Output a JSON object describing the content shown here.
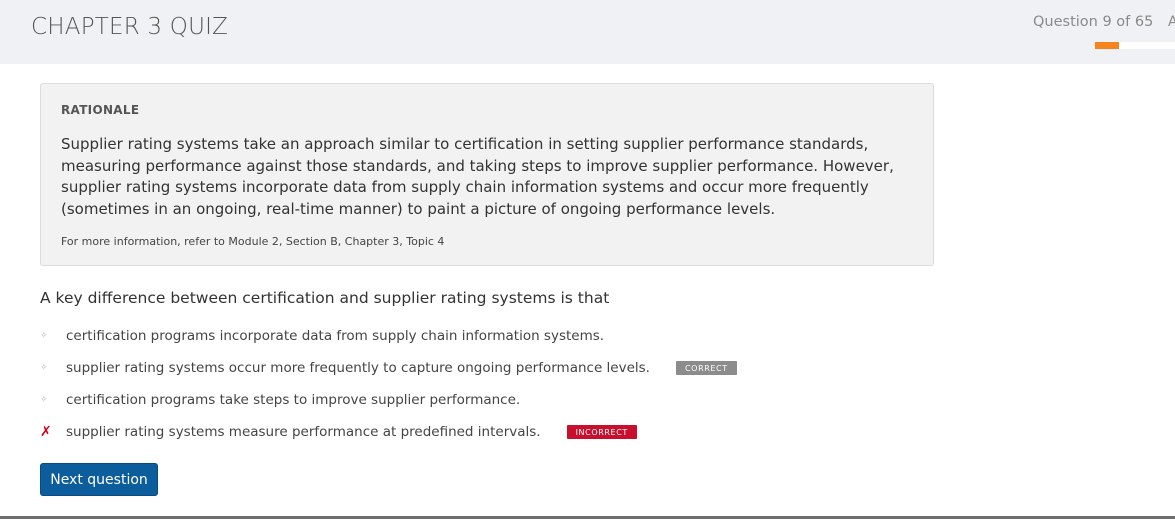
{
  "header": {
    "title": "CHAPTER 3 QUIZ",
    "progress_label": "Question 9 of 65",
    "progress_fraction": 0.3,
    "accent_color": "#f5841f",
    "edge_glyph": "A"
  },
  "rationale": {
    "heading": "RATIONALE",
    "body": "Supplier rating systems take an approach similar to certification in setting supplier performance standards, measuring performance against those standards, and taking steps to improve supplier performance. However, supplier rating systems incorporate data from supply chain information systems and occur more frequently (sometimes in an ongoing, real-time manner) to paint a picture of ongoing performance levels.",
    "reference": "For more information, refer to Module 2, Section B, Chapter 3, Topic 4"
  },
  "question": {
    "text": "A key difference between certification and supplier rating systems is that",
    "answers": [
      {
        "mark": "✧",
        "label": "certification programs incorporate data from supply chain information systems.",
        "badge": ""
      },
      {
        "mark": "✧",
        "label": "supplier rating systems occur more frequently to capture ongoing performance levels.",
        "badge": "CORRECT"
      },
      {
        "mark": "✧",
        "label": "certification programs take steps to improve supplier performance.",
        "badge": ""
      },
      {
        "mark": "✗",
        "label": "supplier rating systems measure performance at predefined intervals.",
        "badge": "INCORRECT"
      }
    ]
  },
  "actions": {
    "next_label": "Next question",
    "next_color": "#0b5d9c"
  }
}
